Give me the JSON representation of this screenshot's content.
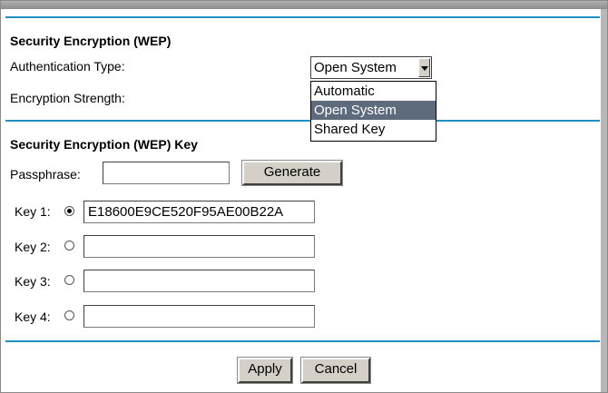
{
  "wep_section": {
    "heading": "Security Encryption (WEP)",
    "auth_type_label": "Authentication Type:",
    "auth_type_selected": "Open System",
    "auth_type_options": [
      "Automatic",
      "Open System",
      "Shared Key"
    ],
    "auth_type_highlighted_index": 1,
    "encryption_strength_label": "Encryption Strength:"
  },
  "key_section": {
    "heading": "Security Encryption (WEP) Key",
    "passphrase_label": "Passphrase:",
    "passphrase_value": "",
    "generate_label": "Generate",
    "keys": [
      {
        "label": "Key 1:",
        "value": "E18600E9CE520F95AE00B22A",
        "selected": true
      },
      {
        "label": "Key 2:",
        "value": "",
        "selected": false
      },
      {
        "label": "Key 3:",
        "value": "",
        "selected": false
      },
      {
        "label": "Key 4:",
        "value": "",
        "selected": false
      }
    ]
  },
  "actions": {
    "apply_label": "Apply",
    "cancel_label": "Cancel"
  },
  "colors": {
    "rule": "#1f8fc4",
    "highlight": "#5d6b7c",
    "button_face": "#d4d0c8"
  }
}
